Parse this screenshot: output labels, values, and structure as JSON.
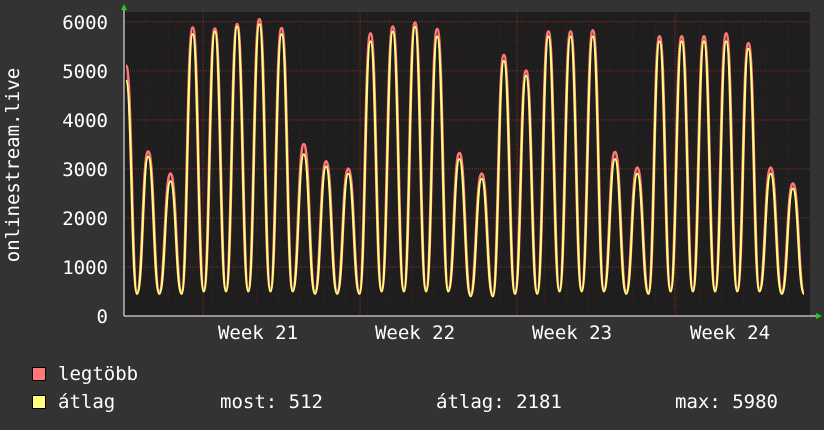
{
  "chart_data": {
    "type": "line",
    "ylabel": "onlinestream.live",
    "ylim": [
      0,
      6200
    ],
    "yticks": [
      0,
      1000,
      2000,
      3000,
      4000,
      5000,
      6000
    ],
    "xlabels": [
      "Week 21",
      "Week 22",
      "Week 23",
      "Week 24"
    ],
    "grid": true,
    "background": "#1e1e1e",
    "axis_color": "#ffffff",
    "grid_color": "#5a2020",
    "series": [
      {
        "name": "legtöbb",
        "color": "#ff7777",
        "values": [
          5100,
          500,
          3350,
          500,
          2900,
          500,
          5880,
          550,
          5860,
          550,
          5950,
          550,
          6050,
          550,
          5870,
          550,
          3500,
          500,
          3150,
          500,
          3000,
          500,
          5760,
          550,
          5900,
          550,
          5980,
          550,
          5850,
          550,
          3320,
          450,
          2900,
          450,
          5320,
          500,
          5000,
          500,
          5800,
          550,
          5800,
          550,
          5820,
          550,
          3340,
          500,
          3020,
          500,
          5700,
          550,
          5700,
          550,
          5700,
          550,
          5760,
          550,
          5560,
          550,
          3020,
          500,
          2700,
          500
        ]
      },
      {
        "name": "átlag",
        "color": "#ffff80",
        "values": [
          4800,
          450,
          3250,
          450,
          2750,
          450,
          5750,
          500,
          5800,
          500,
          5900,
          500,
          5950,
          500,
          5750,
          500,
          3300,
          450,
          3050,
          450,
          2900,
          450,
          5600,
          500,
          5800,
          500,
          5900,
          500,
          5700,
          500,
          3200,
          400,
          2800,
          400,
          5200,
          450,
          4900,
          450,
          5700,
          500,
          5700,
          500,
          5700,
          500,
          3200,
          450,
          2900,
          450,
          5600,
          500,
          5600,
          500,
          5600,
          500,
          5600,
          500,
          5450,
          500,
          2900,
          450,
          2600,
          450
        ]
      }
    ]
  },
  "legend": [
    {
      "label": "legtöbb",
      "color": "#ff7777"
    },
    {
      "label": "átlag",
      "color": "#ffff80"
    }
  ],
  "stats": {
    "most": "most: 512",
    "atlag": "átlag: 2181",
    "max": "max: 5980"
  }
}
